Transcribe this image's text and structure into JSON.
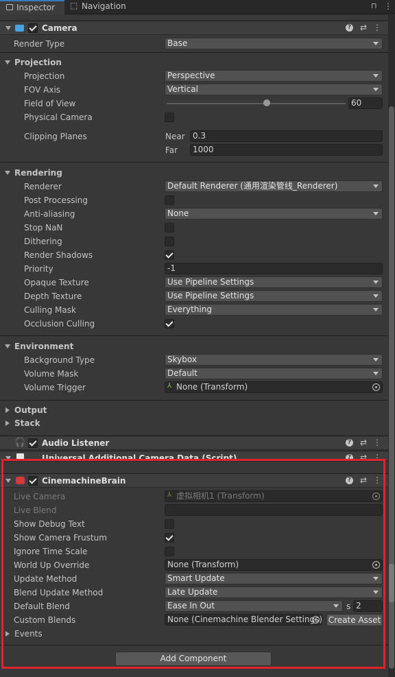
{
  "tabs": [
    {
      "label": "Inspector"
    },
    {
      "label": "Navigation"
    }
  ],
  "camera": {
    "title": "Camera",
    "render_type_label": "Render Type",
    "render_type_value": "Base",
    "projection_section": "Projection",
    "projection_label": "Projection",
    "projection_value": "Perspective",
    "fov_axis_label": "FOV Axis",
    "fov_axis_value": "Vertical",
    "fov_label": "Field of View",
    "fov_value": "60",
    "fov_slider_fraction": 0.56,
    "physical_label": "Physical Camera",
    "clipping_label": "Clipping Planes",
    "near_label": "Near",
    "near_value": "0.3",
    "far_label": "Far",
    "far_value": "1000",
    "rendering_section": "Rendering",
    "renderer_label": "Renderer",
    "renderer_value": "Default Renderer (通用渲染管线_Renderer)",
    "post_label": "Post Processing",
    "aa_label": "Anti-aliasing",
    "aa_value": "None",
    "stopnan_label": "Stop NaN",
    "dither_label": "Dithering",
    "shadows_label": "Render Shadows",
    "priority_label": "Priority",
    "priority_value": "-1",
    "opaque_label": "Opaque Texture",
    "opaque_value": "Use Pipeline Settings",
    "depth_label": "Depth Texture",
    "depth_value": "Use Pipeline Settings",
    "culling_label": "Culling Mask",
    "culling_value": "Everything",
    "occlusion_label": "Occlusion Culling",
    "environment_section": "Environment",
    "bg_label": "Background Type",
    "bg_value": "Skybox",
    "volmask_label": "Volume Mask",
    "volmask_value": "Default",
    "voltrigger_label": "Volume Trigger",
    "voltrigger_value": "None (Transform)",
    "output_section": "Output",
    "stack_section": "Stack"
  },
  "audio_listener": {
    "title": "Audio Listener"
  },
  "uacd": {
    "title": "Universal Additional Camera Data (Script)"
  },
  "brain": {
    "title": "CinemachineBrain",
    "live_camera_label": "Live Camera",
    "live_camera_value": "虚拟相机1 (Transform)",
    "live_blend_label": "Live Blend",
    "debug_label": "Show Debug Text",
    "frustum_label": "Show Camera Frustum",
    "ignore_label": "Ignore Time Scale",
    "worldup_label": "World Up Override",
    "worldup_value": "None (Transform)",
    "update_label": "Update Method",
    "update_value": "Smart Update",
    "blendupdate_label": "Blend Update Method",
    "blendupdate_value": "Late Update",
    "defblend_label": "Default Blend",
    "defblend_value": "Ease In Out",
    "defblend_s_label": "s",
    "defblend_time": "2",
    "custom_label": "Custom Blends",
    "custom_value": "None (Cinemachine Blender Settings)",
    "create_asset_label": "Create Asset",
    "events_section": "Events"
  },
  "add_component_label": "Add Component",
  "colors": {
    "highlight": "#e0232d",
    "accent": "#3a79bb"
  }
}
